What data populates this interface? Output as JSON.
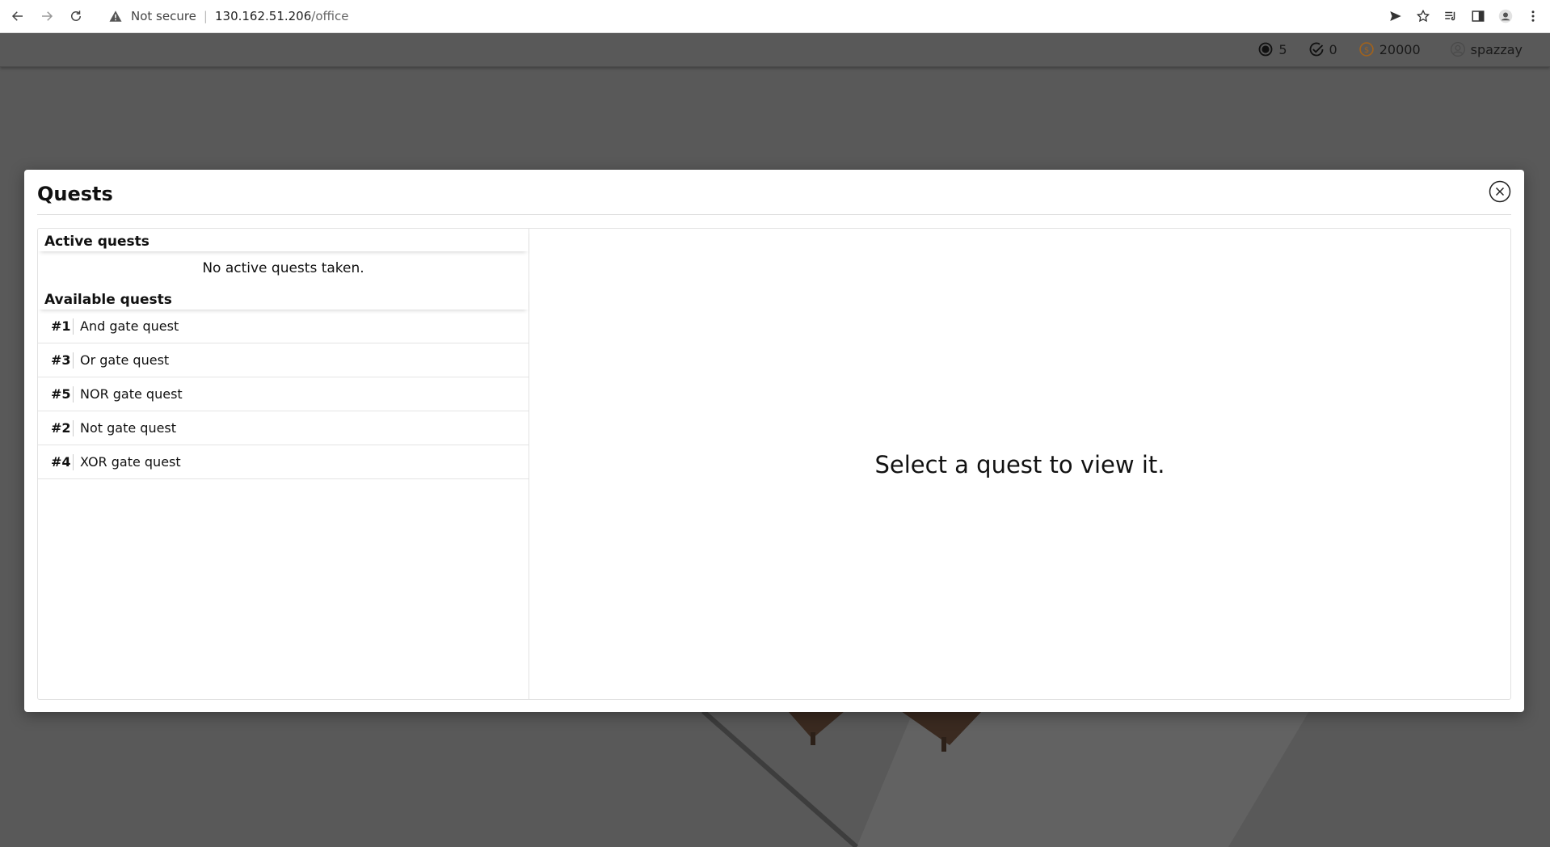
{
  "browser": {
    "security_label": "Not secure",
    "url_host": "130.162.51.206",
    "url_path": "/office"
  },
  "stats": {
    "tokens": "5",
    "completed": "0",
    "coins": "20000",
    "username": "spazzay"
  },
  "modal": {
    "title": "Quests",
    "placeholder": "Select a quest to view it."
  },
  "active_quests": {
    "heading": "Active quests",
    "empty_text": "No active quests taken."
  },
  "available_quests": {
    "heading": "Available quests",
    "items": [
      {
        "id": "#1",
        "name": "And gate quest"
      },
      {
        "id": "#3",
        "name": "Or gate quest"
      },
      {
        "id": "#5",
        "name": "NOR gate quest"
      },
      {
        "id": "#2",
        "name": "Not gate quest"
      },
      {
        "id": "#4",
        "name": "XOR gate quest"
      }
    ]
  },
  "colors": {
    "backdrop": "#595959",
    "coin": "#a0621d"
  }
}
